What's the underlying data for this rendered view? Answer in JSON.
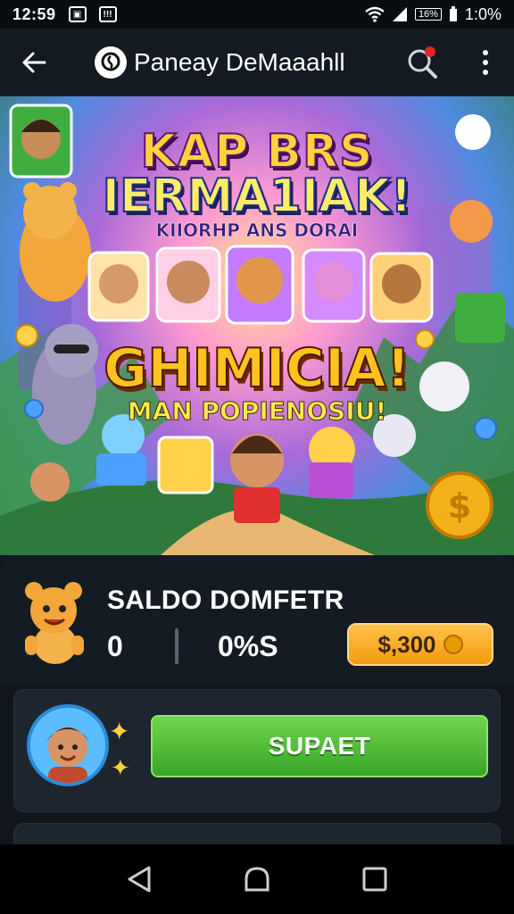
{
  "status_bar": {
    "time": "12:59",
    "notification_badge": "!!!",
    "battery_badge": "16%",
    "battery_text": "1:0%",
    "icons": [
      "image-icon",
      "notification-icon",
      "wifi-icon",
      "signal-icon",
      "battery-icon"
    ]
  },
  "app_bar": {
    "title": "Paneay DeMaaahll",
    "icons": [
      "back-arrow-icon",
      "app-logo-icon",
      "search-icon",
      "more-vert-icon"
    ],
    "search_badge_color": "#e02424"
  },
  "banner": {
    "title_line_1": "KAP BRS",
    "title_line_2": "IERMA1IAK!",
    "tagline_1": "KIIORHP ANS DORAI",
    "title_line_3": "GHIMICIA!",
    "tagline_2": "MAN POPIENOSIU!"
  },
  "balance": {
    "label": "SALDO DOMFETR",
    "value_1": "0",
    "value_2": "0%S",
    "coin_button_label": "$,300",
    "accent_color": "#f39a11"
  },
  "support": {
    "button_label": "SUPAET",
    "button_color": "#3aa52a",
    "sparkle": "✦"
  },
  "nav_bar": {
    "icons": [
      "nav-back-icon",
      "nav-home-icon",
      "nav-recents-icon"
    ]
  }
}
